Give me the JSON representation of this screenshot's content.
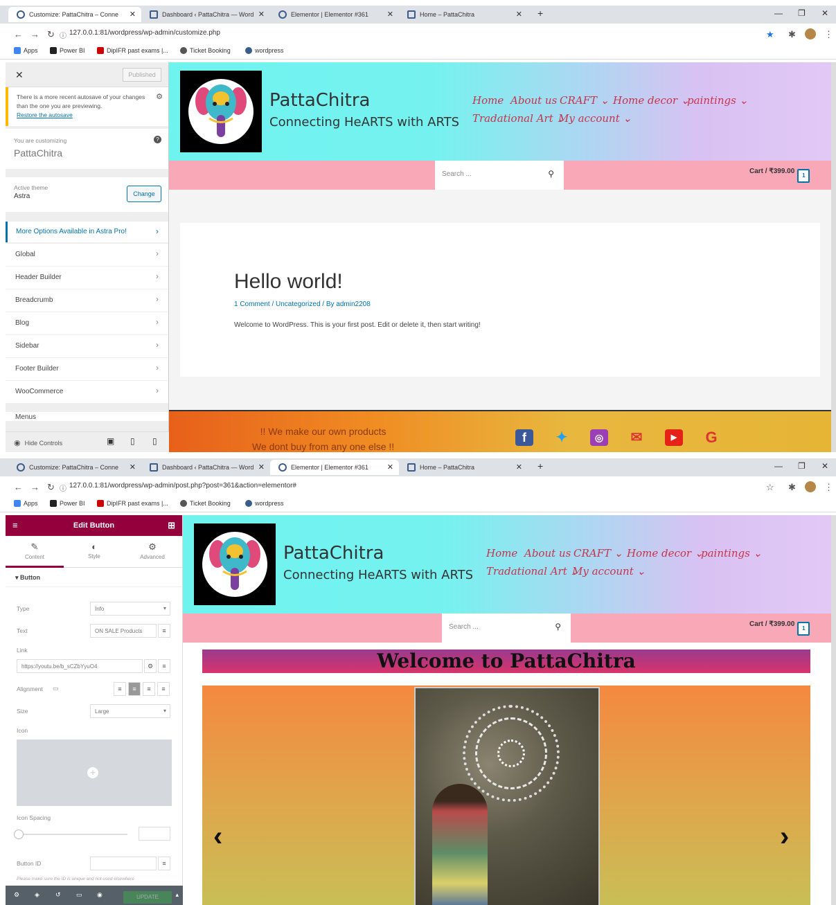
{
  "browser1": {
    "tabs": [
      {
        "title": "Customize: PattaChitra – Conne"
      },
      {
        "title": "Dashboard ‹ PattaChitra — Word"
      },
      {
        "title": "Elementor | Elementor #361"
      },
      {
        "title": "Home – PattaChitra"
      }
    ],
    "url": "127.0.0.1:81/wordpress/wp-admin/customize.php"
  },
  "browser2": {
    "tabs": [
      {
        "title": "Customize: PattaChitra – Conne"
      },
      {
        "title": "Dashboard ‹ PattaChitra — Word"
      },
      {
        "title": "Elementor | Elementor #361"
      },
      {
        "title": "Home – PattaChitra"
      }
    ],
    "url": "127.0.0.1:81/wordpress/wp-admin/post.php?post=361&action=elementor#"
  },
  "bookmarks": [
    "Apps",
    "Power BI",
    "DipIFR past exams |...",
    "Ticket Booking",
    "wordpress"
  ],
  "customizer": {
    "published": "Published",
    "notice": "There is a more recent autosave of your changes than the one you are previewing.",
    "restore": "Restore the autosave",
    "you_are": "You are customizing",
    "site_name": "PattaChitra",
    "active_theme_label": "Active theme",
    "theme": "Astra",
    "change": "Change",
    "more_options": "More Options Available in Astra Pro!",
    "sections": [
      "Global",
      "Header Builder",
      "Breadcrumb",
      "Blog",
      "Sidebar",
      "Footer Builder",
      "WooCommerce",
      "Menus"
    ],
    "hide_controls": "Hide Controls"
  },
  "site": {
    "title": "PattaChitra",
    "tagline": "Connecting HeARTS with ARTS",
    "menu_row1": [
      "Home",
      "About us",
      "CRAFT ⌄",
      "Home decor ⌄",
      "paintings ⌄"
    ],
    "menu_row2": [
      "Tradational Art ⌄",
      "My account ⌄"
    ],
    "search_placeholder": "Search ...",
    "cart": "Cart / ₹399.00",
    "cart_count": "1",
    "post_title": "Hello world!",
    "post_meta": "1 Comment / Uncategorized / By admin2208",
    "post_body": "Welcome to WordPress. This is your first post. Edit or delete it, then start writing!",
    "footer_line1": "!! We make our own products",
    "footer_line2": "We dont buy from any one else !!",
    "welcome": "Welcome to PattaChitra"
  },
  "elementor": {
    "header": "Edit Button",
    "tabs": [
      "Content",
      "Style",
      "Advanced"
    ],
    "section": "Button",
    "type_label": "Type",
    "type_value": "Info",
    "text_label": "Text",
    "text_value": "ON SALE Products",
    "link_label": "Link",
    "link_value": "https://youtu.be/b_sCZbYyuO4",
    "alignment_label": "Alignment",
    "size_label": "Size",
    "size_value": "Large",
    "icon_label": "Icon",
    "icon_spacing_label": "Icon Spacing",
    "button_id_label": "Button ID",
    "note": "Please make sure the ID is unique and not used elsewhere",
    "update": "UPDATE"
  },
  "colors": {
    "wp_blue": "#0073aa",
    "elementor": "#93003c",
    "menu": "#c4344a",
    "pinkbar": "#f9a8b8"
  }
}
